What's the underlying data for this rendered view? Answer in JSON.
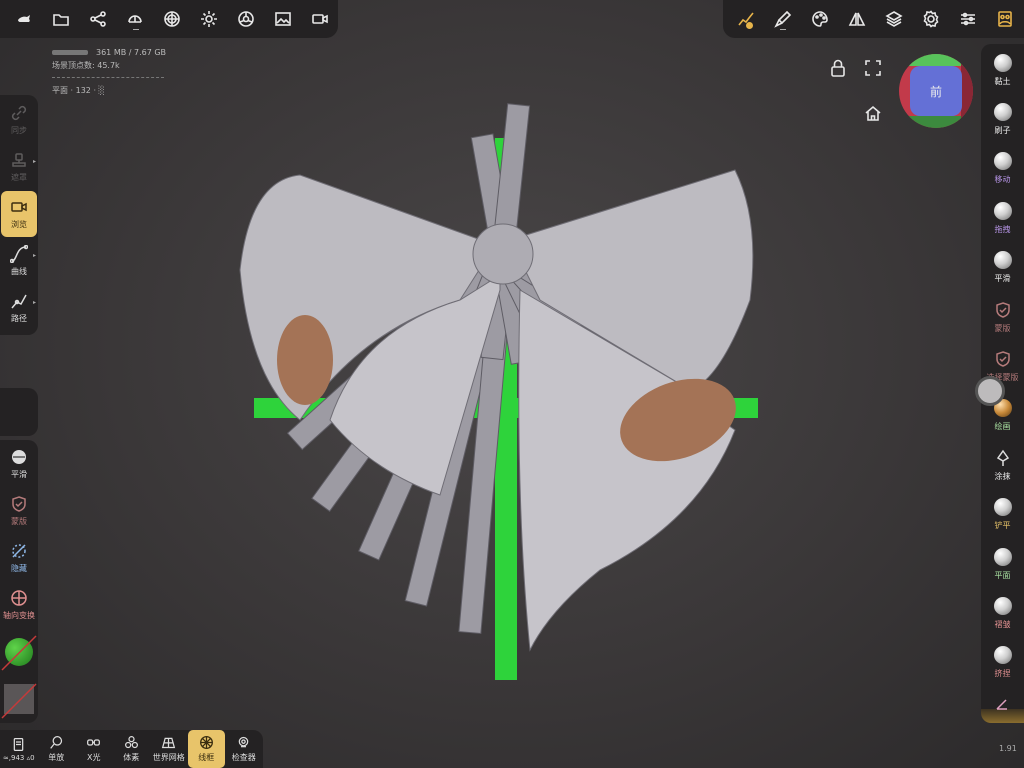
{
  "stats": {
    "memory": "361 MB / 7.67 GB",
    "vertices": "场景顶点数: 45.7k",
    "object": "平面 · 132 · ░"
  },
  "toolbar_left": [
    "app-menu-icon",
    "folder-icon",
    "scene-graph-icon",
    "topology-icon",
    "material-sphere-icon",
    "light-icon",
    "post-process-icon",
    "image-icon",
    "camera-icon"
  ],
  "toolbar_right": [
    "stroke-icon",
    "brush-icon",
    "palette-icon",
    "symmetry-icon",
    "layers-icon",
    "settings-icon",
    "sliders-icon",
    "user-icon"
  ],
  "left_tools_top": [
    {
      "label": "同步",
      "icon": "link-icon",
      "dim": true
    },
    {
      "label": "遮罩",
      "icon": "stamp-icon",
      "dim": true
    },
    {
      "label": "浏览",
      "icon": "camera-icon",
      "active": true
    },
    {
      "label": "曲线",
      "icon": "curve-icon"
    },
    {
      "label": "路径",
      "icon": "path-icon"
    }
  ],
  "left_tools_bottom": [
    {
      "label": "平滑",
      "icon": "smooth-icon"
    },
    {
      "label": "蒙版",
      "icon": "mask-icon"
    },
    {
      "label": "隐藏",
      "icon": "hide-icon"
    },
    {
      "label": "轴向变换",
      "icon": "axis-icon"
    }
  ],
  "right_tools": [
    {
      "label": "黏土",
      "color": "#eeeeee"
    },
    {
      "label": "刷子",
      "color": "#eeeeee"
    },
    {
      "label": "移动",
      "color": "#b896e8"
    },
    {
      "label": "拖拽",
      "color": "#b896e8"
    },
    {
      "label": "平滑",
      "color": "#eeeeee"
    },
    {
      "label": "蒙版",
      "color": "#b57b7b"
    },
    {
      "label": "选择蒙版",
      "color": "#b57b7b"
    },
    {
      "label": "绘画",
      "color": "#a8e0a0"
    },
    {
      "label": "涂抹",
      "color": "#eeeeee"
    },
    {
      "label": "铲平",
      "color": "#e8c46a"
    },
    {
      "label": "平面",
      "color": "#a8e0a0"
    },
    {
      "label": "褶皱",
      "color": "#e09090"
    },
    {
      "label": "挤捏",
      "color": "#e09090"
    }
  ],
  "bottom_tools": [
    {
      "label": "≈,943 ▵0",
      "icon": "scene-icon"
    },
    {
      "label": "单放",
      "icon": "magnify-icon"
    },
    {
      "label": "X光",
      "icon": "xray-icon"
    },
    {
      "label": "体素",
      "icon": "voxel-icon"
    },
    {
      "label": "世界网格",
      "icon": "grid-icon"
    },
    {
      "label": "线框",
      "icon": "wireframe-icon",
      "active": true
    },
    {
      "label": "检查器",
      "icon": "inspector-icon"
    }
  ],
  "gizmo_face": "前",
  "version": "1.91",
  "colors": {
    "accent": "#e8c46a",
    "panel": "#242223",
    "grid_green": "#2ed33b",
    "mesh": "#bfbdc2",
    "inside": "#a47356"
  }
}
